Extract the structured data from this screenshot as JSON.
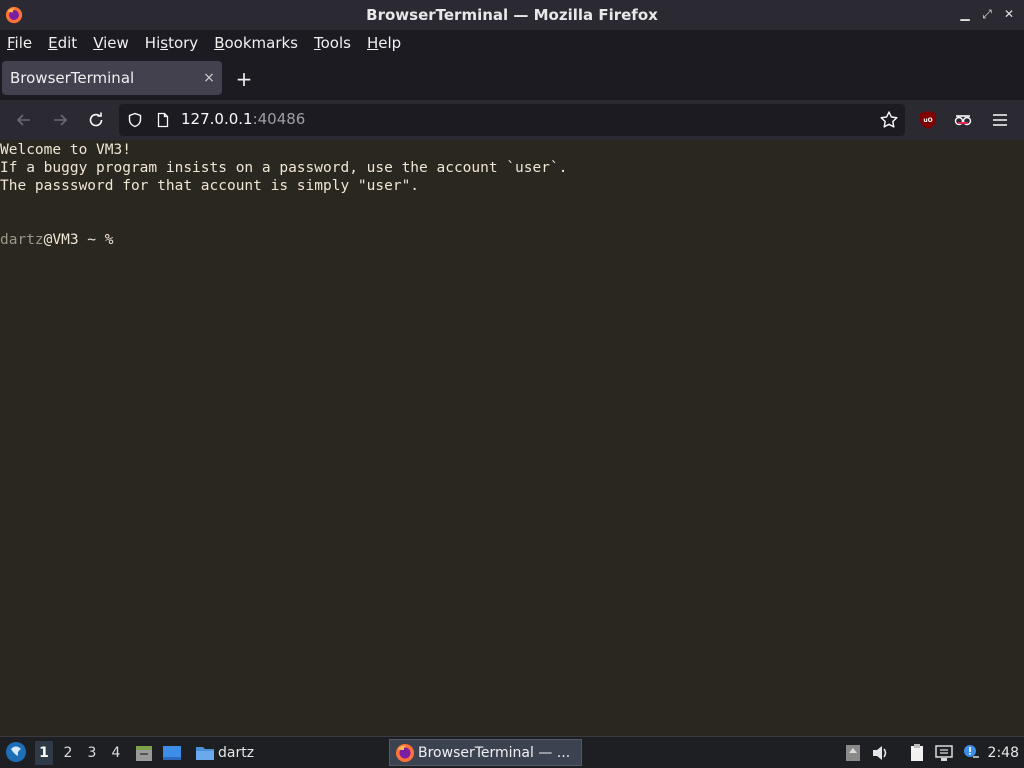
{
  "window": {
    "title": "BrowserTerminal — Mozilla Firefox",
    "controls": [
      "minimize",
      "restore",
      "close"
    ]
  },
  "menu": [
    {
      "label": "File",
      "accel": "F",
      "rest": "ile"
    },
    {
      "label": "Edit",
      "accel": "E",
      "rest": "dit"
    },
    {
      "label": "View",
      "accel": "V",
      "rest": "iew"
    },
    {
      "label": "History",
      "accel": "s",
      "pre": "Hi",
      "rest": "tory"
    },
    {
      "label": "Bookmarks",
      "accel": "B",
      "rest": "ookmarks"
    },
    {
      "label": "Tools",
      "accel": "T",
      "rest": "ools"
    },
    {
      "label": "Help",
      "accel": "H",
      "rest": "elp"
    }
  ],
  "tab": {
    "label": "BrowserTerminal",
    "close": "×"
  },
  "new_tab": "+",
  "url": {
    "host": "127.0.0.1",
    "port": ":40486"
  },
  "terminal": {
    "lines": [
      "Welcome to VM3!",
      "If a buggy program insists on a password, use the account `user`.",
      "The passsword for that account is simply \"user\".",
      "",
      ""
    ],
    "prompt_user": "dartz",
    "prompt_rest": "@VM3 ~ % "
  },
  "taskbar": {
    "workspaces": [
      "1",
      "2",
      "3",
      "4"
    ],
    "active_workspace": "1",
    "folder_label": "dartz",
    "active_task": "BrowserTerminal — ...",
    "clock": "2:48"
  },
  "colors": {
    "terminal_bg": "#2a2620",
    "terminal_fg": "#efe6d4",
    "chrome_bg": "#2b2a33",
    "urlbar_bg": "#1c1b22",
    "taskbar_bg": "#1e1f23"
  }
}
